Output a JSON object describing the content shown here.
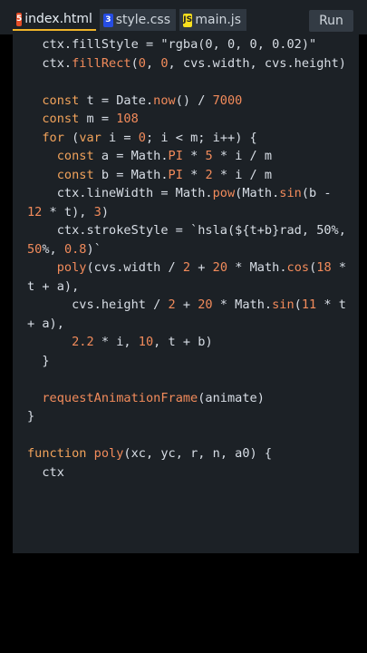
{
  "tabs": [
    {
      "label": "index.html",
      "icon": "html5-icon",
      "active": true
    },
    {
      "label": "style.css",
      "icon": "css3-icon",
      "active": false
    },
    {
      "label": "main.js",
      "icon": "js-icon",
      "active": false
    }
  ],
  "run_label": "Run",
  "code_lines": [
    "  ctx.fillStyle = \"rgba(0, 0, 0, 0.02)\"",
    "  ctx.fillRect(0, 0, cvs.width, cvs.height)",
    "",
    "  const t = Date.now() / 7000",
    "  const m = 108",
    "  for (var i = 0; i < m; i++) {",
    "    const a = Math.PI * 5 * i / m",
    "    const b = Math.PI * 2 * i / m",
    "    ctx.lineWidth = Math.pow(Math.sin(b -",
    "12 * t), 3)",
    "    ctx.strokeStyle = `hsla(${t+b}rad, 50%,",
    "50%, 0.8)`",
    "    poly(cvs.width / 2 + 20 * Math.cos(18 *",
    "t + a),",
    "      cvs.height / 2 + 20 * Math.sin(11 * t",
    "+ a),",
    "      2.2 * i, 10, t + b)",
    "  }",
    "",
    "  requestAnimationFrame(animate)",
    "}",
    "",
    "function poly(xc, yc, r, n, a0) {",
    "  ctx"
  ],
  "colors": {
    "editor_bg": "#1c2126",
    "tab_inactive_bg": "#2f3740",
    "active_tab_underline": "#f0b429",
    "keyword": "#f2a35b",
    "number": "#f28b5b",
    "text": "#d8dee6"
  }
}
